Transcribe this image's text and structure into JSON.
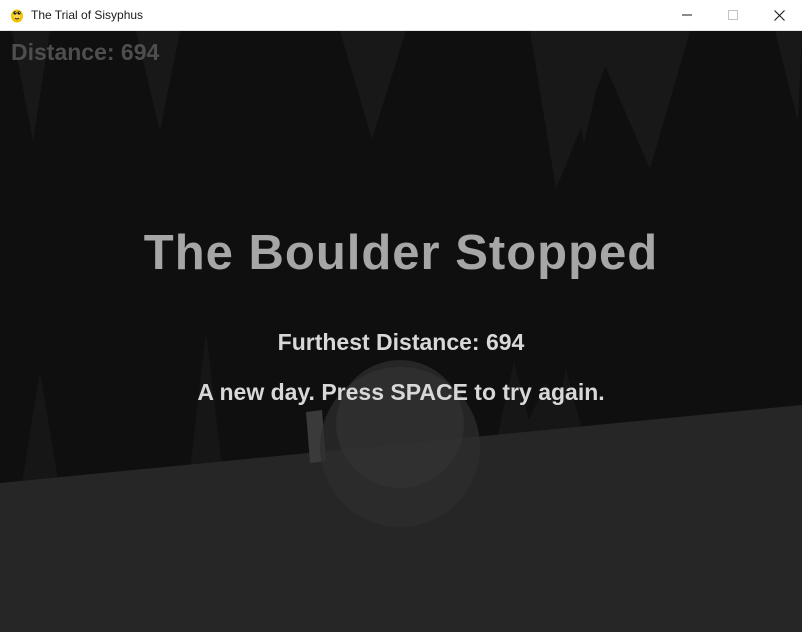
{
  "window": {
    "title": "The Trial of Sisyphus",
    "icon": "pygame-snake-icon",
    "controls": {
      "minimize": "minimize-icon",
      "maximize": "maximize-icon",
      "close": "close-icon"
    }
  },
  "hud": {
    "distance_label": "Distance: 694"
  },
  "game_over": {
    "title": "The Boulder Stopped",
    "best_label": "Furthest Distance: 694",
    "prompt": "A new day. Press SPACE to try again."
  },
  "colors": {
    "background": "#0f0f0f",
    "stalactite": "#191919",
    "ground": "#262626",
    "boulder": "#2e2e2e",
    "title_text": "#a6a6a6",
    "body_text": "#d8d8d8",
    "hud_text": "#4e4e4e"
  }
}
